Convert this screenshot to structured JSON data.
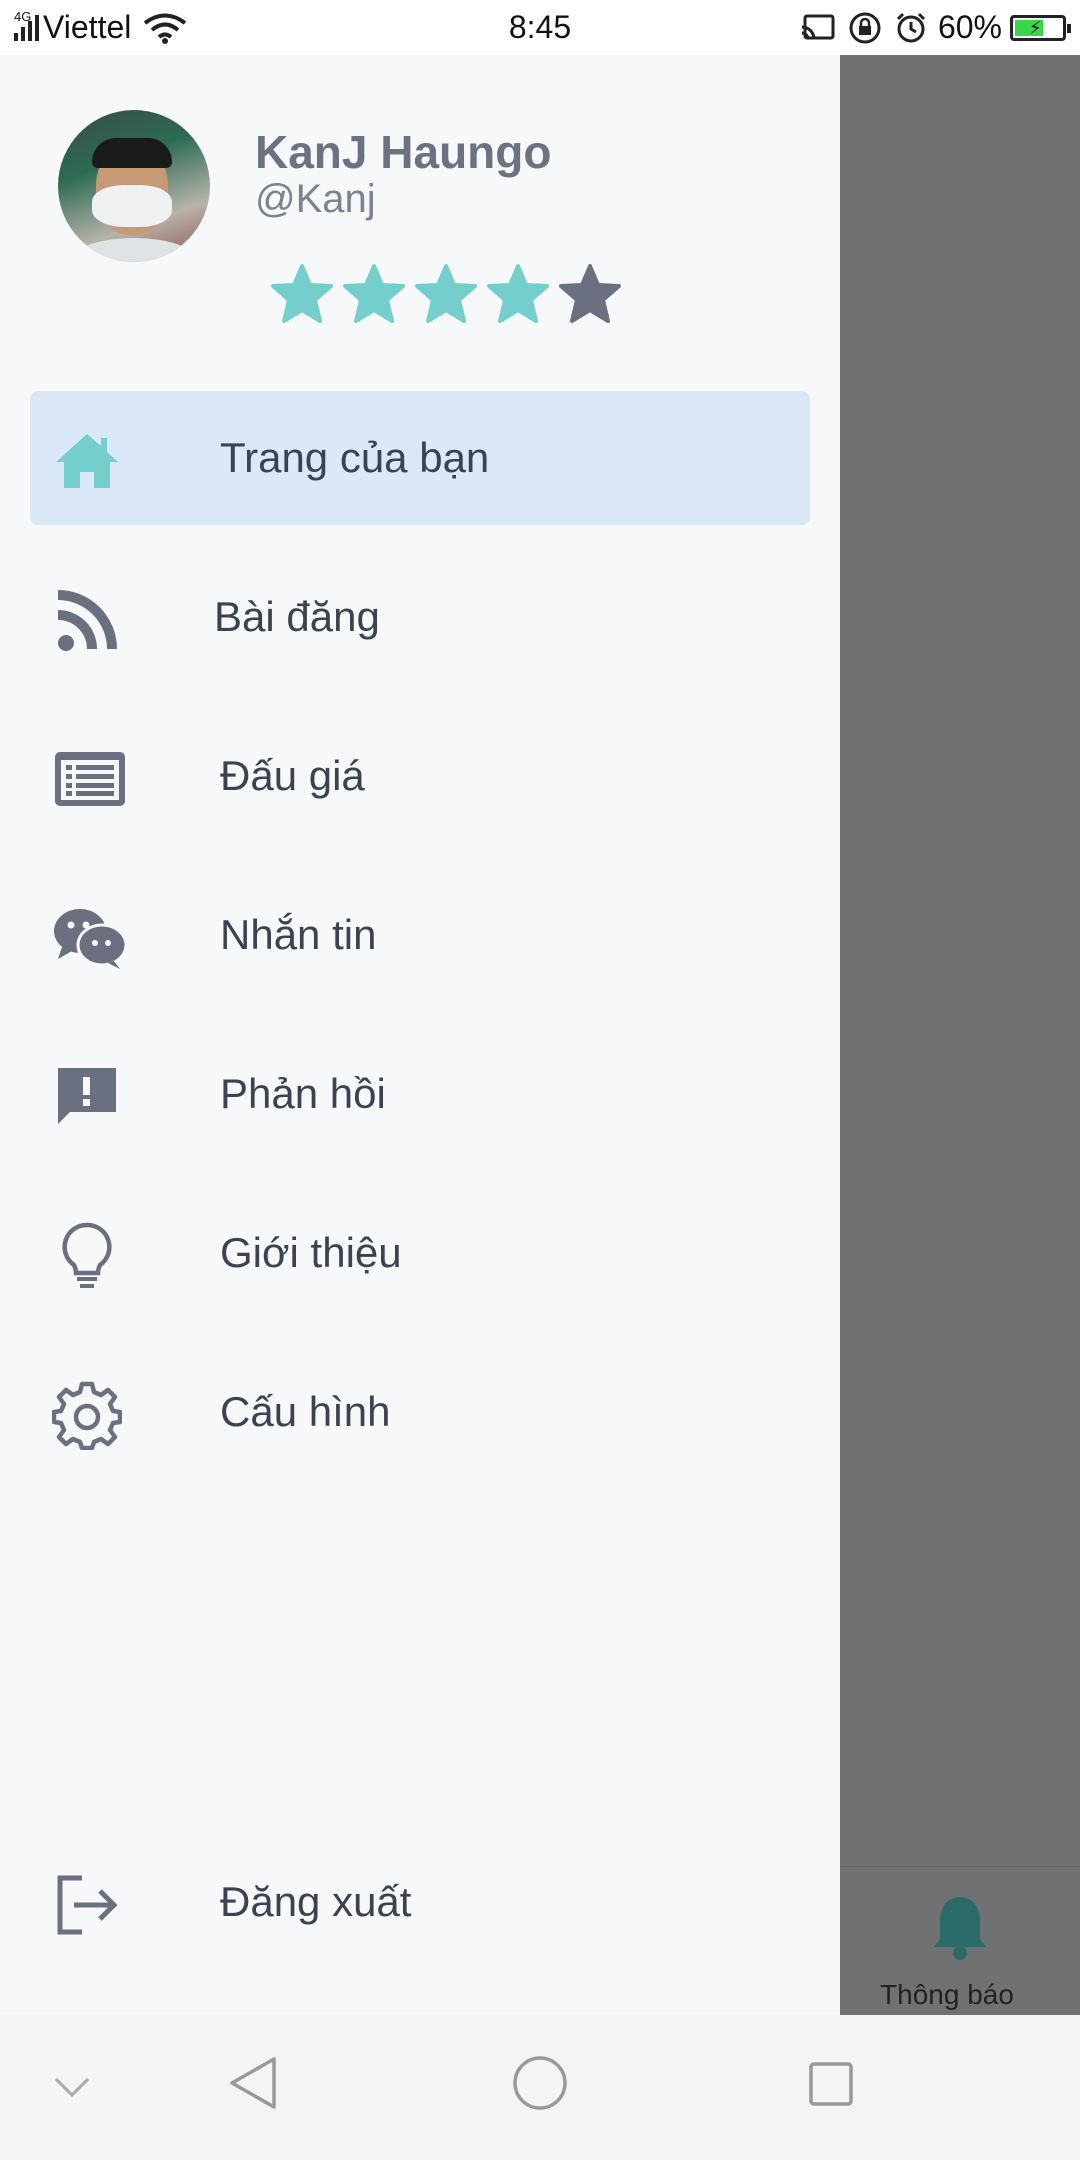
{
  "status_bar": {
    "network_type": "4G",
    "carrier": "Viettel",
    "time": "8:45",
    "battery": "60%",
    "battery_level": 0.6
  },
  "profile": {
    "name": "KanJ Haungo",
    "handle": "@Kanj",
    "rating": 4,
    "rating_max": 5,
    "star_filled_color": "#74cfcc",
    "star_empty_color": "#6b7080"
  },
  "menu": {
    "items": [
      {
        "label": "Trang của bạn",
        "icon": "home-icon"
      },
      {
        "label": "Bài đăng",
        "icon": "rss-icon"
      },
      {
        "label": "Đấu giá",
        "icon": "list-icon"
      },
      {
        "label": "Nhắn tin",
        "icon": "chat-icon"
      },
      {
        "label": "Phản hồi",
        "icon": "feedback-icon"
      },
      {
        "label": "Giới thiệu",
        "icon": "lightbulb-icon"
      },
      {
        "label": "Cấu hình",
        "icon": "gear-icon"
      }
    ],
    "logout_label": "Đăng xuất"
  },
  "background": {
    "notification_label": "Thông báo"
  },
  "colors": {
    "accent": "#74cfcc",
    "active_bg": "#dbe8f8",
    "text": "#3b4252"
  }
}
